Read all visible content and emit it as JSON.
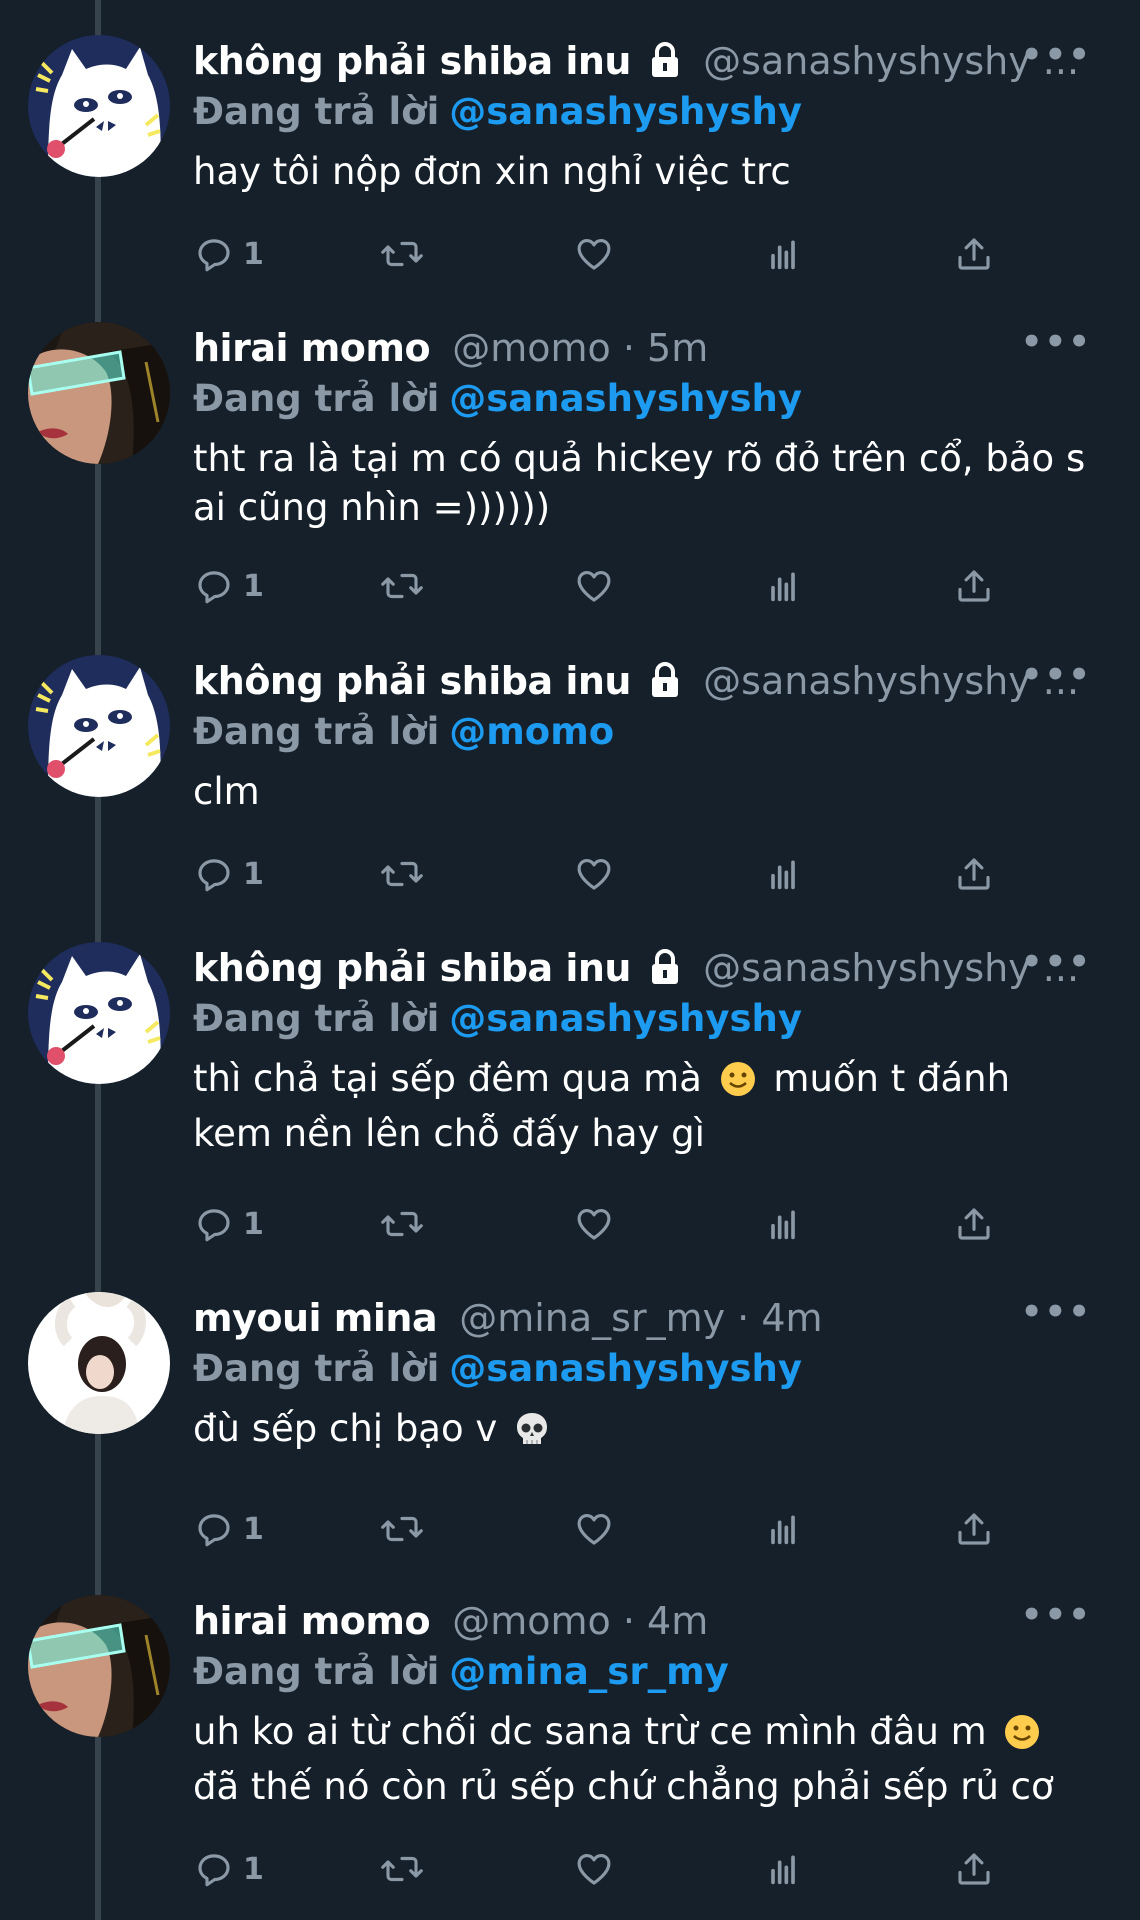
{
  "colors": {
    "background": "#15202b",
    "accent": "#1d9bf0",
    "muted": "#8b98a5"
  },
  "tweets": [
    {
      "name": "không phải shiba inu",
      "locked": true,
      "handle": "@sanashyshyshy ...",
      "dot": "",
      "time": "",
      "reply_prefix": "Đang trả lời",
      "reply_to": "@sanashyshyshy",
      "text": "hay tôi nộp đơn xin nghỉ việc trc",
      "reply_count": "1",
      "avatar": "cat-avatar"
    },
    {
      "name": "hirai momo",
      "locked": false,
      "handle": "@momo",
      "dot": "·",
      "time": "5m",
      "reply_prefix": "Đang trả lời",
      "reply_to": "@sanashyshyshy",
      "text": "tht ra là tại m có quả hickey rõ đỏ trên cổ, bảo s ai cũng nhìn =))))))",
      "reply_count": "1",
      "avatar": "momo-avatar"
    },
    {
      "name": "không phải shiba inu",
      "locked": true,
      "handle": "@sanashyshyshy ...",
      "dot": "",
      "time": "",
      "reply_prefix": "Đang trả lời",
      "reply_to": "@momo",
      "text": "clm",
      "reply_count": "1",
      "avatar": "cat-avatar"
    },
    {
      "name": "không phải shiba inu",
      "locked": true,
      "handle": "@sanashyshyshy ...",
      "dot": "",
      "time": "",
      "reply_prefix": "Đang trả lời",
      "reply_to": "@sanashyshyshy",
      "text_parts": [
        "thì chả tại sếp đêm qua mà ",
        " muốn t đánh kem nền lên chỗ đấy hay gì"
      ],
      "emoji": "slightly-smiling-face",
      "reply_count": "1",
      "avatar": "cat-avatar"
    },
    {
      "name": "myoui mina",
      "locked": false,
      "handle": "@mina_sr_my",
      "dot": "·",
      "time": "4m",
      "reply_prefix": "Đang trả lời",
      "reply_to": "@sanashyshyshy",
      "text_parts": [
        "đù sếp chị bạo v ",
        ""
      ],
      "emoji": "skull",
      "reply_count": "1",
      "avatar": "mina-avatar"
    },
    {
      "name": "hirai momo",
      "locked": false,
      "handle": "@momo",
      "dot": "·",
      "time": "4m",
      "reply_prefix": "Đang trả lời",
      "reply_to": "@mina_sr_my",
      "text_parts": [
        "uh ko ai từ chối dc sana trừ ce mình đâu m ",
        " đã thế nó còn rủ sếp chứ chẳng phải sếp rủ cơ"
      ],
      "emoji": "slightly-smiling-face",
      "reply_count": "1",
      "avatar": "momo-avatar"
    }
  ],
  "more_label": "•••"
}
